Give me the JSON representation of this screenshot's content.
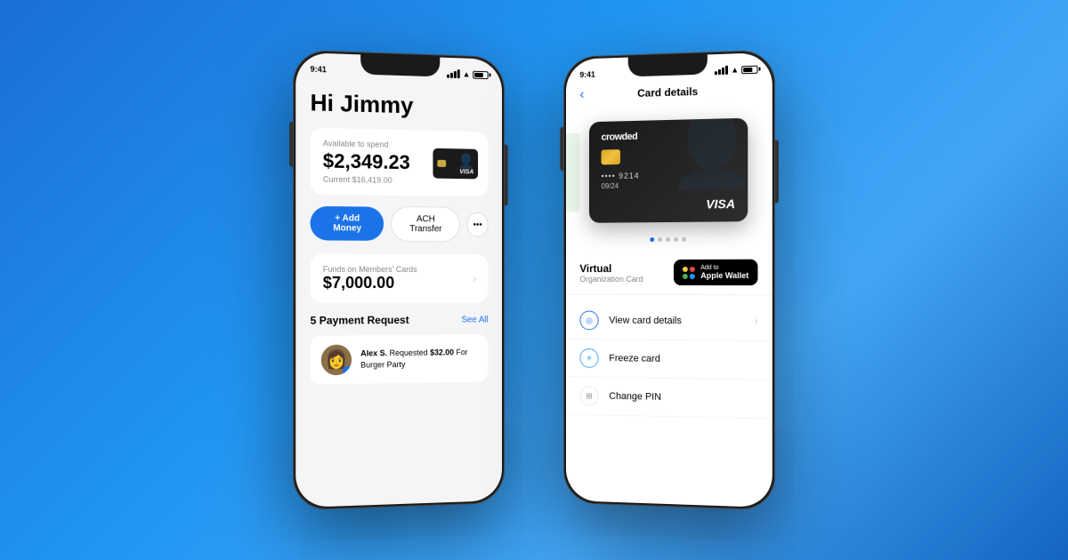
{
  "background": {
    "gradient_start": "#1a6fd4",
    "gradient_end": "#1565c0"
  },
  "phone1": {
    "status_bar": {
      "time": "9:41"
    },
    "greeting": "Hi Jimmy",
    "balance": {
      "label": "Available to spend",
      "amount": "$2,349.23",
      "current_label": "Current",
      "current_amount": "$16,419.00"
    },
    "buttons": {
      "add_money": "+ Add Money",
      "ach_transfer": "ACH Transfer",
      "more": "•••"
    },
    "funds": {
      "label": "Funds on Members' Cards",
      "amount": "$7,000.00"
    },
    "payment_requests": {
      "title": "5 Payment Request",
      "see_all": "See All",
      "items": [
        {
          "name": "Alex S.",
          "action": "Requested",
          "amount": "$32.00",
          "for": "For",
          "description": "Burger Party"
        }
      ]
    }
  },
  "phone2": {
    "status_bar": {
      "time": "9:41"
    },
    "nav": {
      "back": "‹",
      "title": "Card details"
    },
    "card": {
      "brand": "crowded",
      "number": "•••• 9214",
      "expiry": "09/24",
      "network": "VISA"
    },
    "carousel_dots": [
      {
        "active": true
      },
      {
        "active": false
      },
      {
        "active": false
      },
      {
        "active": false
      },
      {
        "active": false
      }
    ],
    "card_info": {
      "type": "Virtual",
      "org_label": "Organization Card"
    },
    "add_wallet": {
      "small_text": "Add to",
      "big_text": "Apple Wallet"
    },
    "menu_items": [
      {
        "icon": "eye",
        "label": "View card details",
        "has_chevron": true
      },
      {
        "icon": "snowflake",
        "label": "Freeze card",
        "has_chevron": false
      },
      {
        "icon": "grid",
        "label": "Change PIN",
        "has_chevron": false
      }
    ]
  }
}
